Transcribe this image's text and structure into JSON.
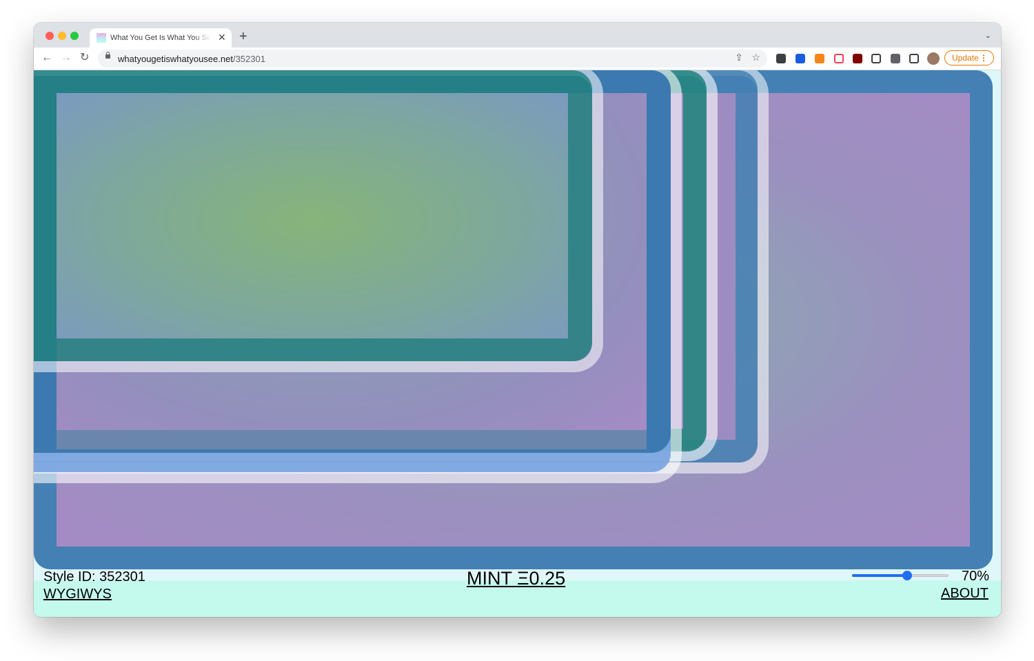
{
  "browser": {
    "tab_title": "What You Get Is What You See",
    "tab_close_icon": "close-icon",
    "new_tab_icon": "plus-icon",
    "url_host": "whatyougetiswhatyousee.net",
    "url_path": "/352301",
    "update_label": "Update",
    "toolbar_icons": [
      "back-arrow-icon",
      "forward-arrow-icon",
      "reload-icon",
      "lock-icon",
      "share-icon",
      "star-icon",
      "extension-plus-icon",
      "bitwarden-icon",
      "metamask-icon",
      "pocket-icon",
      "ublock-icon",
      "screenshot-icon",
      "puzzle-icon",
      "side-panel-icon",
      "profile-avatar"
    ]
  },
  "page": {
    "style_id_label": "Style ID: 352301",
    "wygiwys_link": "WYGIWYS",
    "mint_link": "MINT Ξ0.25",
    "zoom_value": "70%",
    "zoom_fraction": 0.57,
    "about_link": "ABOUT"
  },
  "colors": {
    "page_background": "#e0f7f9",
    "footer_background": "#c4f9ee",
    "frame_blue": "#4480b3",
    "frame_teal": "#27857f",
    "frame_white": "#ffffff",
    "inner_purple": "#a48bc4",
    "inner_green": "#84b87a",
    "slider_accent": "#1f6ff0",
    "update_orange": "#e37400"
  }
}
